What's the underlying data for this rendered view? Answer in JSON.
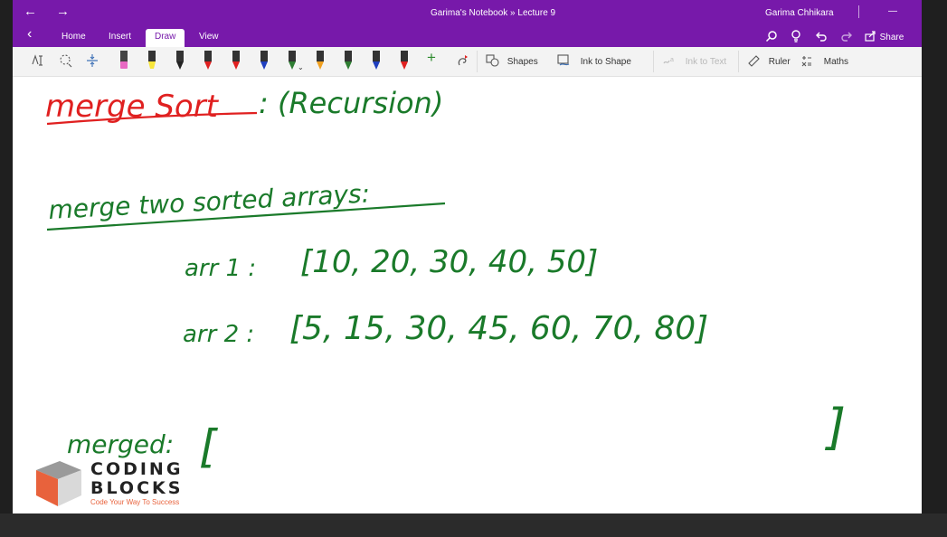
{
  "window": {
    "title": "Garima's Notebook » Lecture 9",
    "user": "Garima Chhikara",
    "minimize_glyph": "—"
  },
  "ribbon": {
    "tabs": [
      "Home",
      "Insert",
      "Draw",
      "View"
    ],
    "active_tab": "Draw",
    "share_label": "Share"
  },
  "toolbar": {
    "shapes_label": "Shapes",
    "ink_to_shape_label": "Ink to Shape",
    "ink_to_text_label": "Ink to Text",
    "ruler_label": "Ruler",
    "maths_label": "Maths",
    "pen_colors": [
      "#e86ac3",
      "#f7e53b",
      "#222222",
      "#e02020",
      "#e02020",
      "#1f3fbf",
      "#2e7d32",
      "#f0a020",
      "#2e7d32",
      "#1f3fbf",
      "#e02020"
    ],
    "add_pen_glyph": "+"
  },
  "note": {
    "heading": "merge Sort",
    "heading_suffix": ": (Recursion)",
    "subheading": "merge two sorted arrays:",
    "arr1_label": "arr 1 :",
    "arr1_values": "[10, 20, 30, 40, 50]",
    "arr2_label": "arr 2 :",
    "arr2_values": "[5, 15, 30, 45, 60, 70, 80]",
    "merged_label": "merged:",
    "merged_open": "[",
    "merged_close": "]"
  },
  "watermark": {
    "line1": "CODING",
    "line2": "BLOCKS",
    "tagline": "Code Your Way To Success"
  },
  "colors": {
    "accent": "#7719aa",
    "ink_red": "#e02020",
    "ink_green": "#1a7a2a"
  }
}
